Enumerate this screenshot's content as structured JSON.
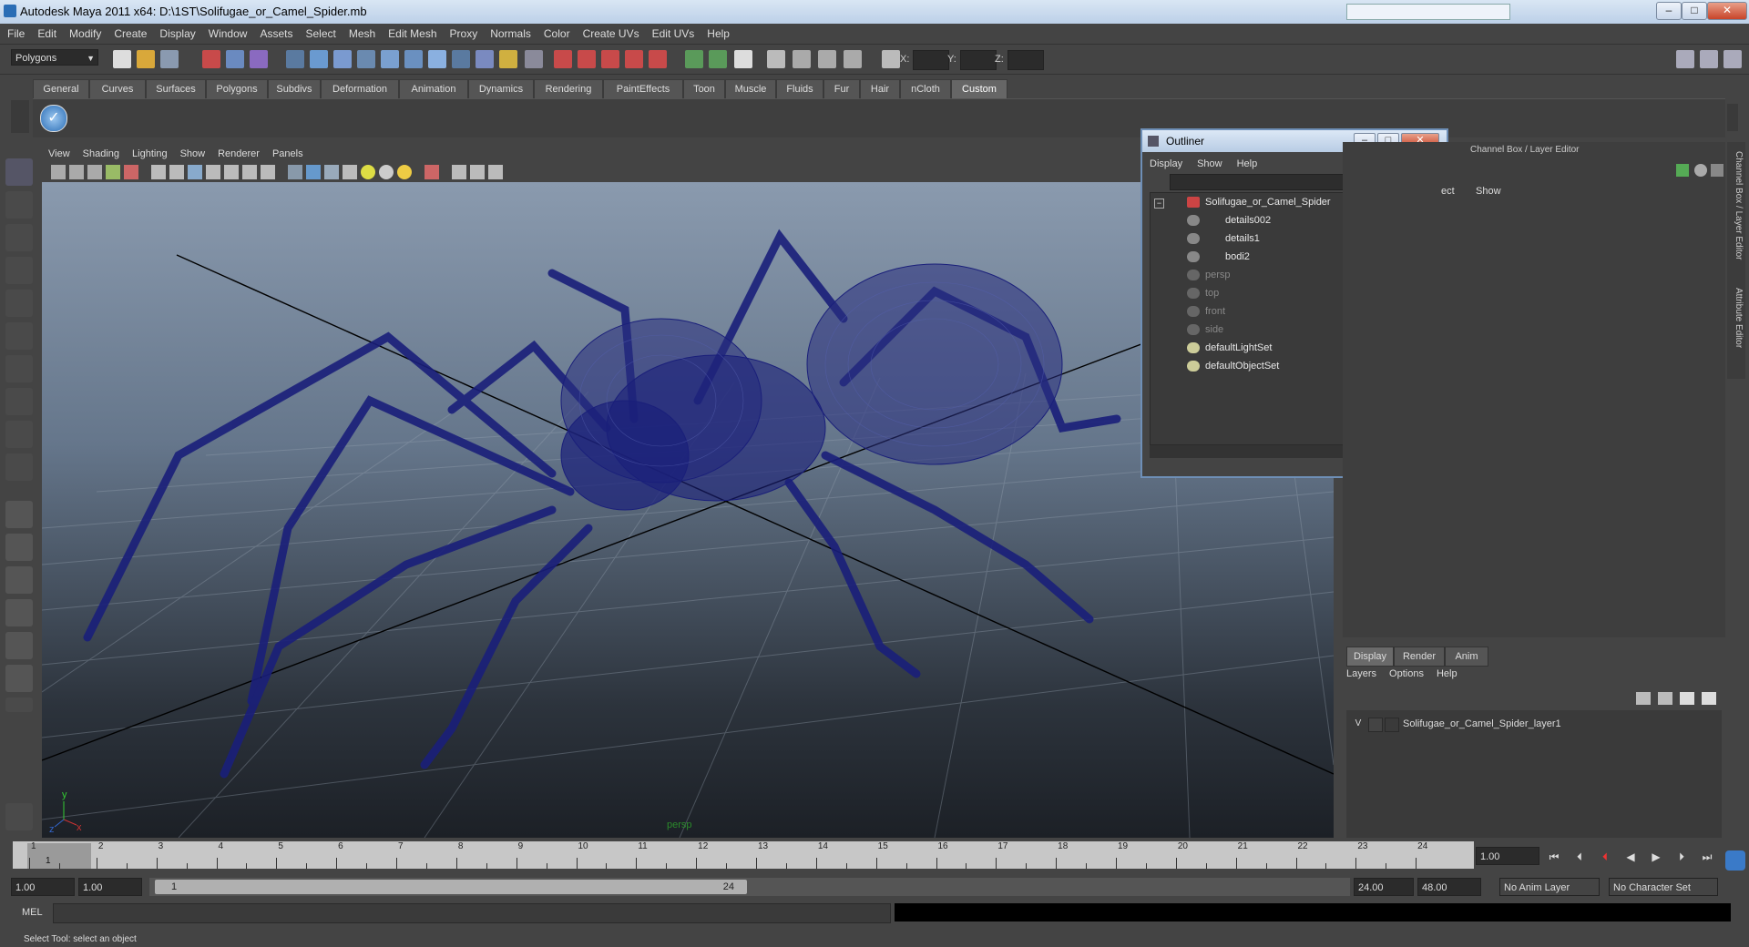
{
  "window": {
    "title": "Autodesk Maya 2011 x64: D:\\1ST\\Solifugae_or_Camel_Spider.mb",
    "min": "–",
    "max": "□",
    "close": "✕"
  },
  "menubar": [
    "File",
    "Edit",
    "Modify",
    "Create",
    "Display",
    "Window",
    "Assets",
    "Select",
    "Mesh",
    "Edit Mesh",
    "Proxy",
    "Normals",
    "Color",
    "Create UVs",
    "Edit UVs",
    "Help"
  ],
  "statusline": {
    "mode": "Polygons",
    "x_label": "X:",
    "y_label": "Y:",
    "z_label": "Z:"
  },
  "shelf_tabs": [
    "General",
    "Curves",
    "Surfaces",
    "Polygons",
    "Subdivs",
    "Deformation",
    "Animation",
    "Dynamics",
    "Rendering",
    "PaintEffects",
    "Toon",
    "Muscle",
    "Fluids",
    "Fur",
    "Hair",
    "nCloth",
    "Custom"
  ],
  "shelf_active": "Custom",
  "viewport": {
    "menu": [
      "View",
      "Shading",
      "Lighting",
      "Show",
      "Renderer",
      "Panels"
    ],
    "camera_label": "persp"
  },
  "outliner": {
    "title": "Outliner",
    "menu": [
      "Display",
      "Show",
      "Help"
    ],
    "items": [
      {
        "label": "Solifugae_or_Camel_Spider",
        "dim": false
      },
      {
        "label": "details002",
        "dim": false
      },
      {
        "label": "details1",
        "dim": false
      },
      {
        "label": "bodi2",
        "dim": false
      },
      {
        "label": "persp",
        "dim": true
      },
      {
        "label": "top",
        "dim": true
      },
      {
        "label": "front",
        "dim": true
      },
      {
        "label": "side",
        "dim": true
      },
      {
        "label": "defaultLightSet",
        "dim": false
      },
      {
        "label": "defaultObjectSet",
        "dim": false
      }
    ]
  },
  "channel_box": {
    "title": "Channel Box / Layer Editor",
    "menu_fragment": "ect",
    "menu_show": "Show"
  },
  "layer_editor": {
    "tabs": [
      "Display",
      "Render",
      "Anim"
    ],
    "menu": [
      "Layers",
      "Options",
      "Help"
    ],
    "layer": {
      "visible": "V",
      "name": "Solifugae_or_Camel_Spider_layer1"
    }
  },
  "side_tabs": [
    "Channel Box / Layer Editor",
    "Attribute Editor"
  ],
  "time_slider": {
    "ticks": [
      "1",
      "2",
      "3",
      "4",
      "5",
      "6",
      "7",
      "8",
      "9",
      "10",
      "11",
      "12",
      "13",
      "14",
      "15",
      "16",
      "17",
      "18",
      "19",
      "20",
      "21",
      "22",
      "23",
      "24"
    ],
    "current_frame": "1",
    "current_field": "1.00"
  },
  "range": {
    "start": "1.00",
    "start2": "1.00",
    "handle_start": "1",
    "handle_end": "24",
    "end": "24.00",
    "end2": "48.00",
    "anim_layer": "No Anim Layer",
    "char_set": "No Character Set"
  },
  "command": {
    "mel": "MEL"
  },
  "help_line": "Select Tool: select an object",
  "colors": {
    "wire": "#1a1f7a",
    "viewport_top": "#8a9aae",
    "viewport_bottom": "#1c2026"
  }
}
